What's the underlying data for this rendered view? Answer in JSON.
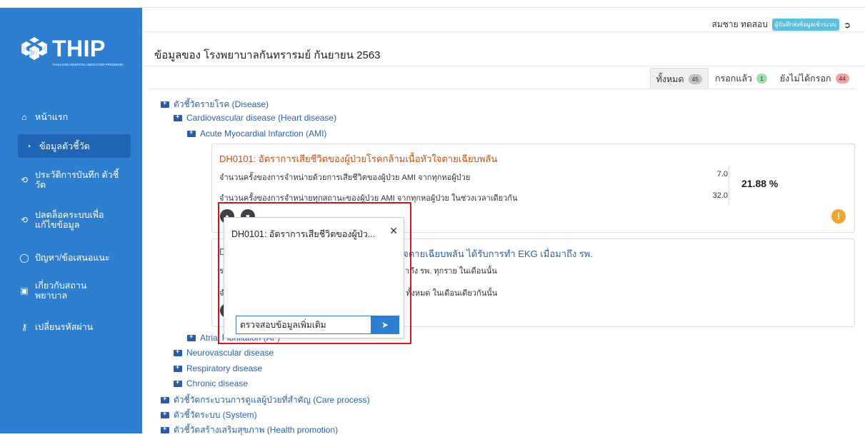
{
  "app": {
    "brand": "THIP",
    "brand_sub": "THAILAND HOSPITAL INDICATOR PROGRAM"
  },
  "sidebar": {
    "items": [
      {
        "icon": "home-icon",
        "label": "หน้าแรก"
      },
      {
        "icon": "dashboard-icon",
        "label": "ข้อมูลตัวชี้วัด"
      },
      {
        "icon": "history-icon",
        "label": "ประวัติการบันทึก ตัวชี้วัด"
      },
      {
        "icon": "unlock-history-icon",
        "label": "ปลดล็อคระบบเพื่อ แก้ไขข้อมูล"
      },
      {
        "icon": "chat-icon",
        "label": "ปัญหา/ข้อเสนอแนะ"
      },
      {
        "icon": "hospital-icon",
        "label": "เกี่ยวกับสถาน พยาบาล"
      },
      {
        "icon": "key-icon",
        "label": "เปลี่ยนรหัสผ่าน"
      }
    ]
  },
  "header": {
    "user_name": "สมชาย ทดสอบ",
    "user_role": "ผู้บันทึกส่งข้อมูลเข้าระบบ"
  },
  "page": {
    "title": "ข้อมูลของ โรงพยาบาลกันทรารมย์ กันยายน 2563"
  },
  "tabs": [
    {
      "label": "ทั้งหมด",
      "count": "45"
    },
    {
      "label": "กรอกแล้ว",
      "count": "1"
    },
    {
      "label": "ยังไม่ได้กรอก",
      "count": "44"
    }
  ],
  "tree": {
    "disease": "ตัวชี้วัดรายโรค (Disease)",
    "cardio": "Cardiovascular disease (Heart disease)",
    "ami": "Acute Myocardial Infarction (AMI)",
    "af": "Atrial Fibrillation (AF)",
    "neuro": "Neurovascular disease",
    "resp": "Respiratory disease",
    "chronic": "Chronic disease",
    "care": "ตัวชี้วัดกระบวนการดูแลผู้ป่วยที่สำคัญ (Care process)",
    "system": "ตัวชี้วัดระบบ (System)",
    "health": "ตัวชี้วัดสร้างเสริมสุขภาพ (Health promotion)"
  },
  "card1": {
    "title": "DH0101: อัตราการเสียชีวิตของผู้ป่วยโรคกล้ามเนื้อหัวใจตายเฉียบพลัน",
    "line1": "จำนวนครั้งของการจำหน่ายด้วยการเสียชีวิตของผู้ป่วย AMI จากทุกหอผู้ป่วย",
    "value1": "7.0",
    "line2": "จำนวนครั้งของการจำหน่ายทุกสถานะของผู้ป่วย AMI จากทุกหอผู้ป่วย ในช่วงเวลาเดียวกัน",
    "value2": "32.0",
    "result": "21.88 %"
  },
  "card2": {
    "title_prefix": "DH",
    "title_suffix": "หัวใจตายเฉียบพลัน ได้รับการทำ EKG เมื่อมาถึง รพ.",
    "line1_prefix": "ระย",
    "line1_suffix": "เมื่อมาถึง รพ. ทุกราย ในเดือนนั้น",
    "line2_prefix": "จำน",
    "line2_suffix": "EKG ทั้งหมด ในเดือนเดียวกันนั้น"
  },
  "popup": {
    "title": "DH0101: อัตราการเสียชีวิตของผู้ป่ว...",
    "input_value": "ตรวจสอบข้อมูลเพิ่มเติม"
  },
  "colors": {
    "sidebar": "#2f7fd0",
    "accent": "#2a62b0",
    "title_orange": "#c0501a",
    "highlight": "#c9181e",
    "warning": "#f0a62e"
  }
}
